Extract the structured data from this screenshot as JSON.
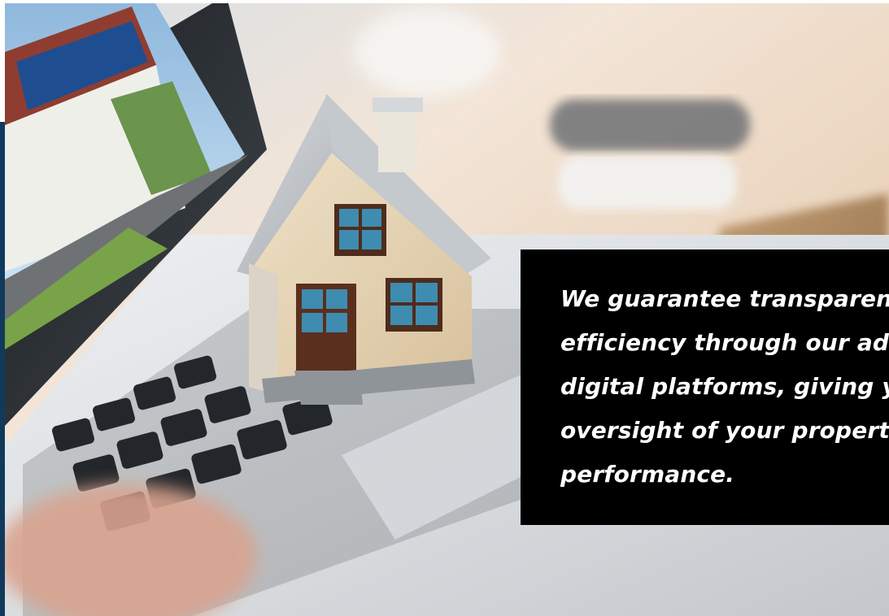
{
  "caption": {
    "text": "We guarantee transparency and\nefficiency through our advanced\ndigital platforms, giving you\noversight of your property's\nperformance."
  },
  "colors": {
    "caption_background": "#000000",
    "caption_text": "#ffffff",
    "edge_bar": "#0f3a5c"
  },
  "image": {
    "subject_icons": [
      "house-model-icon",
      "laptop-icon",
      "solar-panel-house-photo-icon"
    ]
  }
}
